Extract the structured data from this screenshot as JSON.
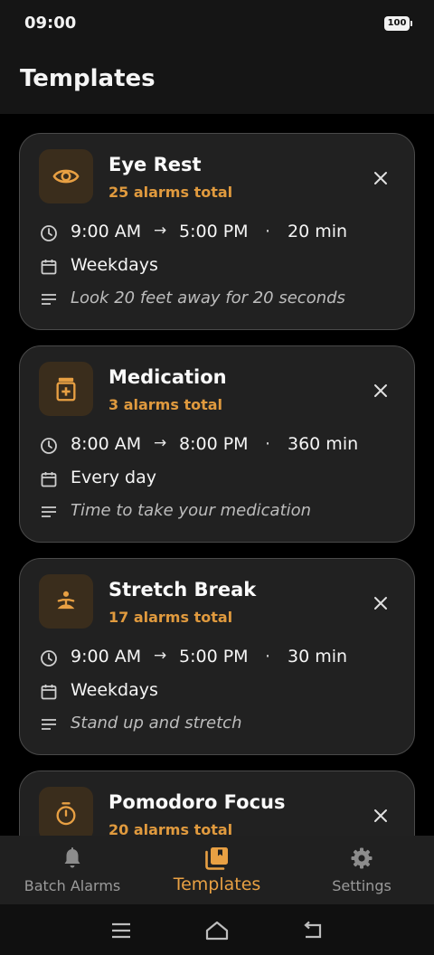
{
  "status_bar": {
    "time": "09:00",
    "battery": "100"
  },
  "header": {
    "title": "Templates"
  },
  "templates": [
    {
      "name": "Eye Rest",
      "count": "25 alarms total",
      "start": "9:00 AM",
      "end": "5:00 PM",
      "interval": "20 min",
      "days": "Weekdays",
      "message": "Look 20 feet away for 20 seconds",
      "icon": "eye-icon"
    },
    {
      "name": "Medication",
      "count": "3 alarms total",
      "start": "8:00 AM",
      "end": "8:00 PM",
      "interval": "360 min",
      "days": "Every day",
      "message": "Time to take your medication",
      "icon": "medication-icon"
    },
    {
      "name": "Stretch Break",
      "count": "17 alarms total",
      "start": "9:00 AM",
      "end": "5:00 PM",
      "interval": "30 min",
      "days": "Weekdays",
      "message": "Stand up and stretch",
      "icon": "meditation-icon"
    },
    {
      "name": "Pomodoro Focus",
      "count": "20 alarms total",
      "icon": "timer-icon"
    }
  ],
  "separators": {
    "arrow": "→",
    "dot": "·"
  },
  "bottom_nav": [
    {
      "label": "Batch Alarms",
      "icon": "bell-icon",
      "active": false
    },
    {
      "label": "Templates",
      "icon": "templates-icon",
      "active": true
    },
    {
      "label": "Settings",
      "icon": "gear-icon",
      "active": false
    }
  ],
  "colors": {
    "accent": "#e8a043",
    "card_bg": "#212121",
    "background": "#000000"
  }
}
